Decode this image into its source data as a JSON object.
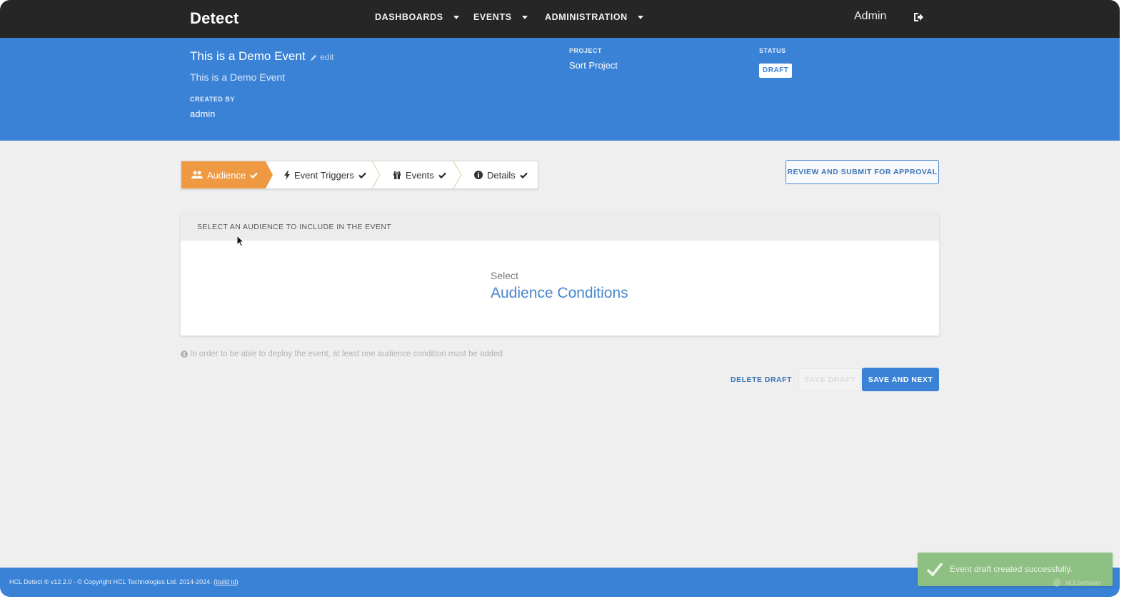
{
  "app": {
    "logo": "Detect",
    "nav": [
      {
        "label": "DASHBOARDS"
      },
      {
        "label": "EVENTS"
      },
      {
        "label": "ADMINISTRATION"
      }
    ],
    "user": "Admin"
  },
  "event": {
    "title": "This is a Demo Event",
    "edit_label": "edit",
    "description": "This is a Demo Event",
    "created_by_label": "CREATED BY",
    "created_by": "admin",
    "project_label": "PROJECT",
    "project": "Sort Project",
    "status_label": "STATUS",
    "status": "DRAFT"
  },
  "wizard": {
    "steps": [
      {
        "label": "Audience",
        "icon": "users-icon",
        "active": true,
        "completed": true
      },
      {
        "label": "Event Triggers",
        "icon": "bolt-icon",
        "active": false,
        "completed": true
      },
      {
        "label": "Events",
        "icon": "gift-icon",
        "active": false,
        "completed": true
      },
      {
        "label": "Details",
        "icon": "info-icon",
        "active": false,
        "completed": true
      }
    ]
  },
  "actions": {
    "review": "REVIEW AND SUBMIT FOR APPROVAL",
    "delete_draft": "DELETE DRAFT",
    "save_draft": "SAVE DRAFT",
    "save_next": "SAVE AND NEXT"
  },
  "audience_panel": {
    "title": "SELECT AN AUDIENCE TO INCLUDE IN THE EVENT",
    "select_label": "Select",
    "link": "Audience Conditions"
  },
  "info_note": "In order to be able to deploy the event, at least one audience condition must be added",
  "footer": {
    "text": "HCL Detect ® v12.2.0 - © Copyright HCL Technologies Ltd. 2014-2024. (",
    "build_link": "build id",
    "suffix": ")"
  },
  "toast": {
    "message": "Event draft created successfully.",
    "brand": "HCLSoftware"
  },
  "colors": {
    "primary": "#3a82d6",
    "nav_bg": "#262626",
    "active_step": "#ef9a43",
    "toast": "#8ebf83"
  }
}
